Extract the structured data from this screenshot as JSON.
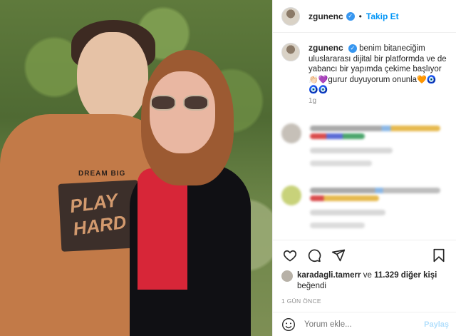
{
  "header": {
    "username": "zgunenc",
    "verified_symbol": "✓",
    "separator": "•",
    "follow_label": "Takip Et"
  },
  "caption": {
    "username": "zgunenc",
    "text_line1": "benim bitaneciğim",
    "text_line2": "uluslararası dijital bir platformda ve de",
    "text_line3": "yabancı bir yapımda çekime başlıyor",
    "line4_emojis": "👏🏻💜",
    "text_line4": "gurur duyuyorum onunla",
    "line4_end_emojis": "🧡🧿",
    "line5_emojis": "🧿🧿",
    "age": "1g"
  },
  "actions": {
    "liker_username": "karadagli.tamerr",
    "likes_connector": "ve",
    "likes_count": "11.329 diğer kişi",
    "likes_suffix": "beğendi",
    "timestamp": "1 GÜN ÖNCE"
  },
  "comment_box": {
    "placeholder": "Yorum ekle...",
    "post_label": "Paylaş"
  },
  "photo": {
    "print_top": "DREAM BIG",
    "print_main_1": "PLAY",
    "print_main_2": "HARD"
  },
  "colors": {
    "accent": "#0095f6",
    "verified": "#3897f0"
  }
}
